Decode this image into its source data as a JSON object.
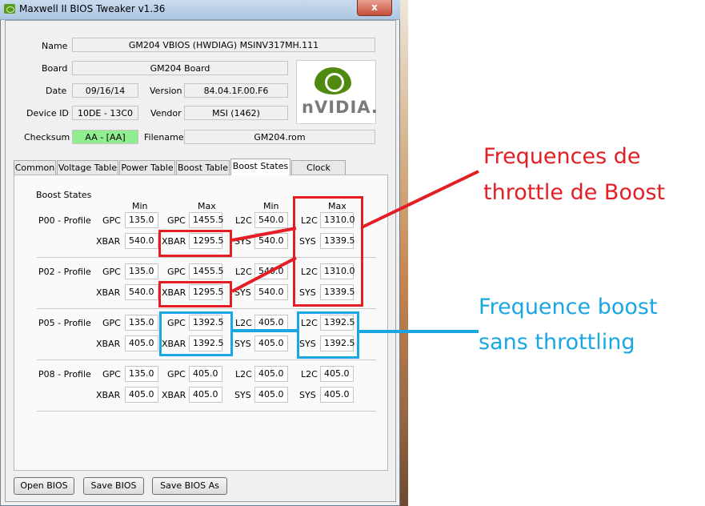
{
  "window": {
    "title": "Maxwell II BIOS Tweaker v1.36",
    "close": "x"
  },
  "info": {
    "name_label": "Name",
    "name_value": "GM204 VBIOS (HWDIAG) MSINV317MH.111",
    "board_label": "Board",
    "board_value": "GM204 Board",
    "date_label": "Date",
    "date_value": "09/16/14",
    "version_label": "Version",
    "version_value": "84.04.1F.00.F6",
    "device_label": "Device ID",
    "device_value": "10DE - 13C0",
    "vendor_label": "Vendor",
    "vendor_value": "MSI (1462)",
    "checksum_label": "Checksum",
    "checksum_value": "AA - [AA]",
    "filename_label": "Filename",
    "filename_value": "GM204.rom",
    "logo_text": "nVIDIA."
  },
  "tabs": [
    "Common",
    "Voltage Table",
    "Power Table",
    "Boost Table",
    "Boost States",
    "Clock States"
  ],
  "boost": {
    "group_title": "Boost States",
    "headers": [
      "Min",
      "Max",
      "Min",
      "Max"
    ],
    "rows": [
      {
        "profile": "P00 - Profile",
        "gpc_min": "135.0",
        "gpc_max": "1455.5",
        "l2c_min": "540.0",
        "l2c_max": "1310.0",
        "xbar_min": "540.0",
        "xbar_max": "1295.5",
        "sys_min": "540.0",
        "sys_max": "1339.5"
      },
      {
        "profile": "P02 - Profile",
        "gpc_min": "135.0",
        "gpc_max": "1455.5",
        "l2c_min": "540.0",
        "l2c_max": "1310.0",
        "xbar_min": "540.0",
        "xbar_max": "1295.5",
        "sys_min": "540.0",
        "sys_max": "1339.5"
      },
      {
        "profile": "P05 - Profile",
        "gpc_min": "135.0",
        "gpc_max": "1392.5",
        "l2c_min": "405.0",
        "l2c_max": "1392.5",
        "xbar_min": "405.0",
        "xbar_max": "1392.5",
        "sys_min": "405.0",
        "sys_max": "1392.5"
      },
      {
        "profile": "P08 - Profile",
        "gpc_min": "135.0",
        "gpc_max": "405.0",
        "l2c_min": "405.0",
        "l2c_max": "405.0",
        "xbar_min": "405.0",
        "xbar_max": "405.0",
        "sys_min": "405.0",
        "sys_max": "405.0"
      }
    ],
    "labels": {
      "gpc": "GPC",
      "xbar": "XBAR",
      "l2c": "L2C",
      "sys": "SYS"
    }
  },
  "buttons": {
    "open": "Open BIOS",
    "save": "Save BIOS",
    "save_as": "Save BIOS As"
  },
  "annotations": {
    "red_line1": "Frequences de",
    "red_line2": "throttle de Boost",
    "blue_line1": "Frequence boost",
    "blue_line2": "sans throttling",
    "red_color": "#e31e24",
    "blue_color": "#1aa6e3"
  }
}
